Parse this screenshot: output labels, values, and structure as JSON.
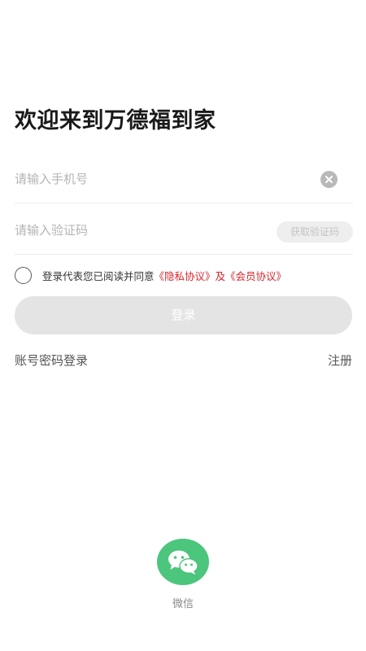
{
  "header": {
    "title": "欢迎来到万德福到家"
  },
  "form": {
    "phone": {
      "value": "",
      "placeholder": "请输入手机号",
      "clear_icon": "close-circle-icon"
    },
    "code": {
      "value": "",
      "placeholder": "请输入验证码",
      "get_code_label": "获取验证码"
    }
  },
  "agreement": {
    "prefix": "登录代表您已阅读并同意",
    "privacy_label": "《隐私协议》",
    "joiner": "及",
    "member_label": "《会员协议》",
    "checked": false
  },
  "actions": {
    "login_label": "登录",
    "password_login_label": "账号密码登录",
    "register_label": "注册"
  },
  "third_party": {
    "wechat_label": "微信",
    "wechat_icon": "wechat-icon"
  },
  "colors": {
    "accent_red": "#d7262c",
    "wechat_green": "#4cc57d",
    "disabled_gray": "#e4e4e4"
  }
}
